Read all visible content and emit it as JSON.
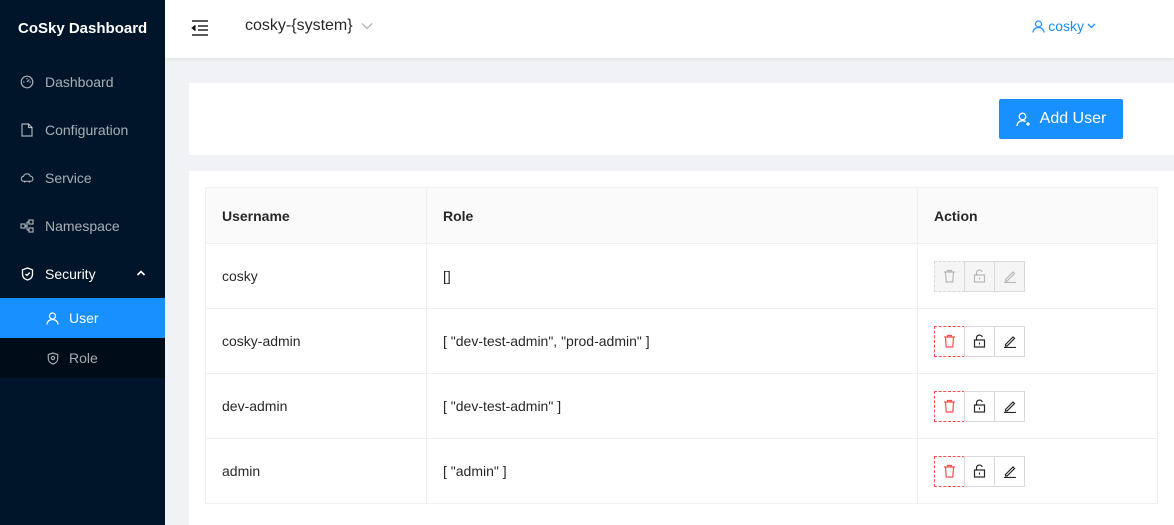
{
  "app": {
    "title": "CoSky Dashboard"
  },
  "sidebar": {
    "items": [
      {
        "label": "Dashboard",
        "icon": "dashboard-icon"
      },
      {
        "label": "Configuration",
        "icon": "file-icon"
      },
      {
        "label": "Service",
        "icon": "cloud-icon"
      },
      {
        "label": "Namespace",
        "icon": "cluster-icon"
      },
      {
        "label": "Security",
        "icon": "safety-icon",
        "expanded": true
      }
    ],
    "security_sub": [
      {
        "label": "User",
        "icon": "user-icon",
        "active": true
      },
      {
        "label": "Role",
        "icon": "shield-icon",
        "active": false
      }
    ]
  },
  "header": {
    "namespace": "cosky-{system}",
    "user": "cosky"
  },
  "toolbar": {
    "add_user_label": "Add User"
  },
  "table": {
    "columns": [
      "Username",
      "Role",
      "Action"
    ],
    "rows": [
      {
        "username": "cosky",
        "role": "[]",
        "actions_disabled": true
      },
      {
        "username": "cosky-admin",
        "role": "[ \"dev-test-admin\", \"prod-admin\" ]",
        "actions_disabled": false
      },
      {
        "username": "dev-admin",
        "role": "[ \"dev-test-admin\" ]",
        "actions_disabled": false
      },
      {
        "username": "admin",
        "role": "[ \"admin\" ]",
        "actions_disabled": false
      }
    ]
  },
  "colors": {
    "primary": "#1890ff",
    "danger": "#ff4d4f",
    "sider": "#001529"
  }
}
